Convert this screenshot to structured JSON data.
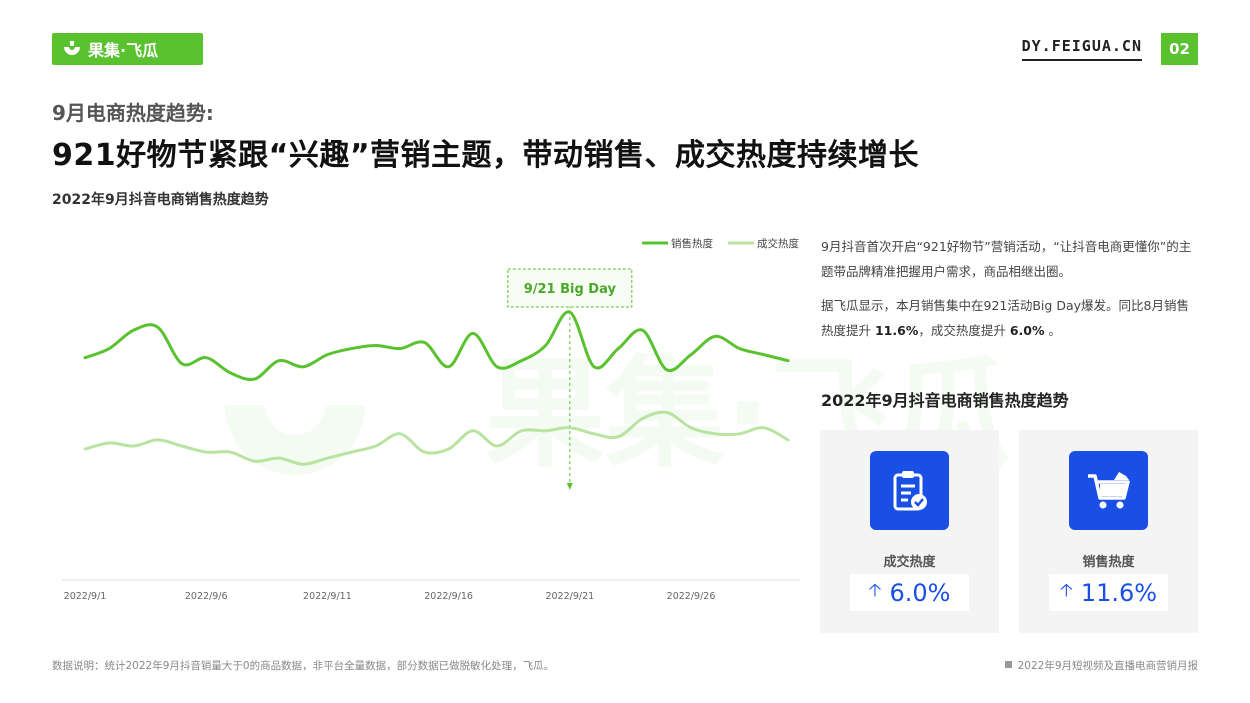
{
  "header": {
    "brand": "果集·飞瓜",
    "site": "DY.FEIGUA.CN",
    "page_number": "02"
  },
  "section_label": "9月电商热度趋势:",
  "headline": "921好物节紧跟“兴趣”营销主题，带动销售、成交热度持续增长",
  "chart_title": "2022年9月抖音电商销售热度趋势",
  "chart_data": {
    "type": "line",
    "x": [
      "2022/9/1",
      "2022/9/2",
      "2022/9/3",
      "2022/9/4",
      "2022/9/5",
      "2022/9/6",
      "2022/9/7",
      "2022/9/8",
      "2022/9/9",
      "2022/9/10",
      "2022/9/11",
      "2022/9/12",
      "2022/9/13",
      "2022/9/14",
      "2022/9/15",
      "2022/9/16",
      "2022/9/17",
      "2022/9/18",
      "2022/9/19",
      "2022/9/20",
      "2022/9/21",
      "2022/9/22",
      "2022/9/23",
      "2022/9/24",
      "2022/9/25",
      "2022/9/26",
      "2022/9/27",
      "2022/9/28",
      "2022/9/29",
      "2022/9/30"
    ],
    "tick_labels": [
      "2022/9/1",
      "2022/9/6",
      "2022/9/11",
      "2022/9/16",
      "2022/9/21",
      "2022/9/26"
    ],
    "series": [
      {
        "name": "销售热度",
        "color": "#5ac12f",
        "values": [
          73,
          76,
          82,
          83,
          71,
          73,
          68,
          66,
          72,
          70,
          74,
          76,
          77,
          76,
          78,
          70,
          81,
          70,
          72,
          77,
          88,
          70,
          76,
          82,
          69,
          74,
          80,
          76,
          74,
          72
        ]
      },
      {
        "name": "成交热度",
        "color": "#b8e3a0",
        "values": [
          43,
          45,
          44,
          46,
          44,
          42,
          42,
          39,
          40,
          38,
          40,
          42,
          44,
          48,
          42,
          43,
          49,
          44,
          49,
          49,
          50,
          48,
          47,
          53,
          55,
          50,
          48,
          48,
          50,
          46
        ]
      }
    ],
    "ylim": [
      0,
      110
    ],
    "legend": "top-right",
    "annotation": {
      "x": "2022/9/21",
      "text": "9/21 Big Day"
    },
    "grid": false
  },
  "description": {
    "p1": "9月抖音首次开启“921好物节”营销活动，“让抖音电商更懂你”的主题带品牌精准把握用户需求，商品相继出圈。",
    "p2_prefix": "据飞瓜显示，本月销售集中在921活动Big Day爆发。同比8月销售热度提升 ",
    "p2_sales": "11.6%",
    "p2_mid": "，成交热度提升 ",
    "p2_deal": "6.0%",
    "p2_suffix": " 。"
  },
  "right_title": "2022年9月抖音电商销售热度趋势",
  "cards": [
    {
      "label": "成交热度",
      "value": "6.0%",
      "icon": "clipboard-check-icon"
    },
    {
      "label": "销售热度",
      "value": "11.6%",
      "icon": "shopping-cart-icon"
    }
  ],
  "footer": {
    "note": "数据说明：统计2022年9月抖音销量大于0的商品数据，非平台全量数据，部分数据已做脱敏化处理，飞瓜。",
    "report": "2022年9月短视频及直播电商营销月报"
  },
  "colors": {
    "brand_green": "#5ac12f",
    "light_green": "#b8e3a0",
    "accent_blue": "#1a4fe6"
  }
}
